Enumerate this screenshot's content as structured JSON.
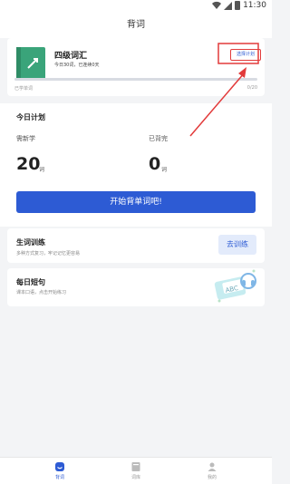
{
  "status_bar": {
    "time": "11:30"
  },
  "header": {
    "title": "背词"
  },
  "book": {
    "title": "四级词汇",
    "stats": "今日30词，已连续0天",
    "change_plan_label": "选择计划",
    "progress_label": "已学单词",
    "progress_count": "0/20",
    "progress": 0
  },
  "today_plan": {
    "title": "今日计划",
    "new_label": "需新学",
    "new_value": "20",
    "new_unit": "词",
    "review_label": "已背完",
    "review_value": "0",
    "review_unit": "词",
    "start_button": "开始背单词吧!"
  },
  "training": {
    "title": "生词训练",
    "desc": "多种方式复习，牢记记忆更容易",
    "button": "去训练"
  },
  "daily_quote": {
    "title": "每日短句",
    "desc": "课本口语，点击开始练习"
  },
  "bottom_nav": {
    "items": [
      {
        "label": "背词",
        "icon": "smile-icon",
        "active": true
      },
      {
        "label": "词库",
        "icon": "book-icon",
        "active": false
      },
      {
        "label": "我的",
        "icon": "person-icon",
        "active": false
      }
    ]
  },
  "colors": {
    "accent": "#2d5bd4",
    "annotation": "#e23a3a",
    "book_cover": "#3aa47a"
  }
}
